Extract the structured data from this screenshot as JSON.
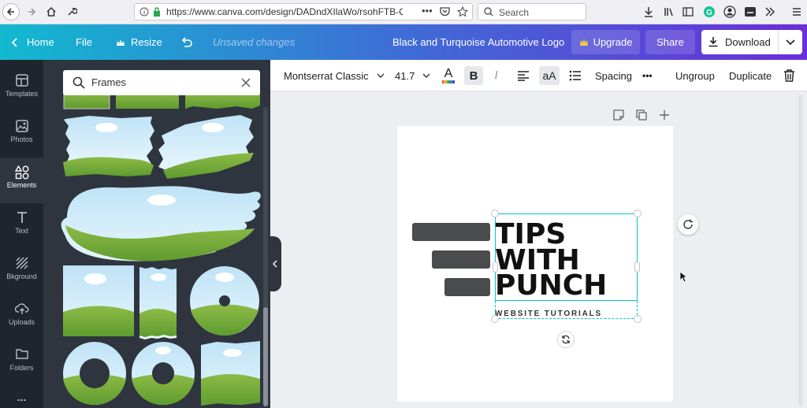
{
  "browser": {
    "url": "https://www.canva.com/design/DADndXIlaWo/rsohFTB-Q",
    "search_placeholder": "Search"
  },
  "topbar": {
    "home": "Home",
    "file": "File",
    "resize": "Resize",
    "status": "Unsaved changes",
    "design_title": "Black and Turquoise Automotive Logo",
    "upgrade": "Upgrade",
    "share": "Share",
    "download": "Download"
  },
  "rail": {
    "items": [
      {
        "label": "Templates",
        "icon": "templates-icon"
      },
      {
        "label": "Photos",
        "icon": "photos-icon"
      },
      {
        "label": "Elements",
        "icon": "elements-icon"
      },
      {
        "label": "Text",
        "icon": "text-icon"
      },
      {
        "label": "Bkground",
        "icon": "background-icon"
      },
      {
        "label": "Uploads",
        "icon": "uploads-icon"
      },
      {
        "label": "Folders",
        "icon": "folders-icon"
      },
      {
        "label": "...",
        "icon": "more-icon"
      }
    ],
    "active": "Elements"
  },
  "panel": {
    "search_value": "Frames"
  },
  "toolbar": {
    "font": "Montserrat Classic",
    "size": "41.7",
    "color_letter": "A",
    "bold": "B",
    "italic": "I",
    "case": "aA",
    "spacing": "Spacing",
    "more": "•••",
    "ungroup": "Ungroup",
    "duplicate": "Duplicate"
  },
  "canvas": {
    "headline": [
      "TIPS",
      "WITH",
      "PUNCH"
    ],
    "tagline": "WEBSITE TUTORIALS"
  },
  "colors": {
    "accent": "#00c4cc",
    "rail": "#1f252d",
    "panel": "#2e353e",
    "upgrade_crown": "#f7c948"
  }
}
